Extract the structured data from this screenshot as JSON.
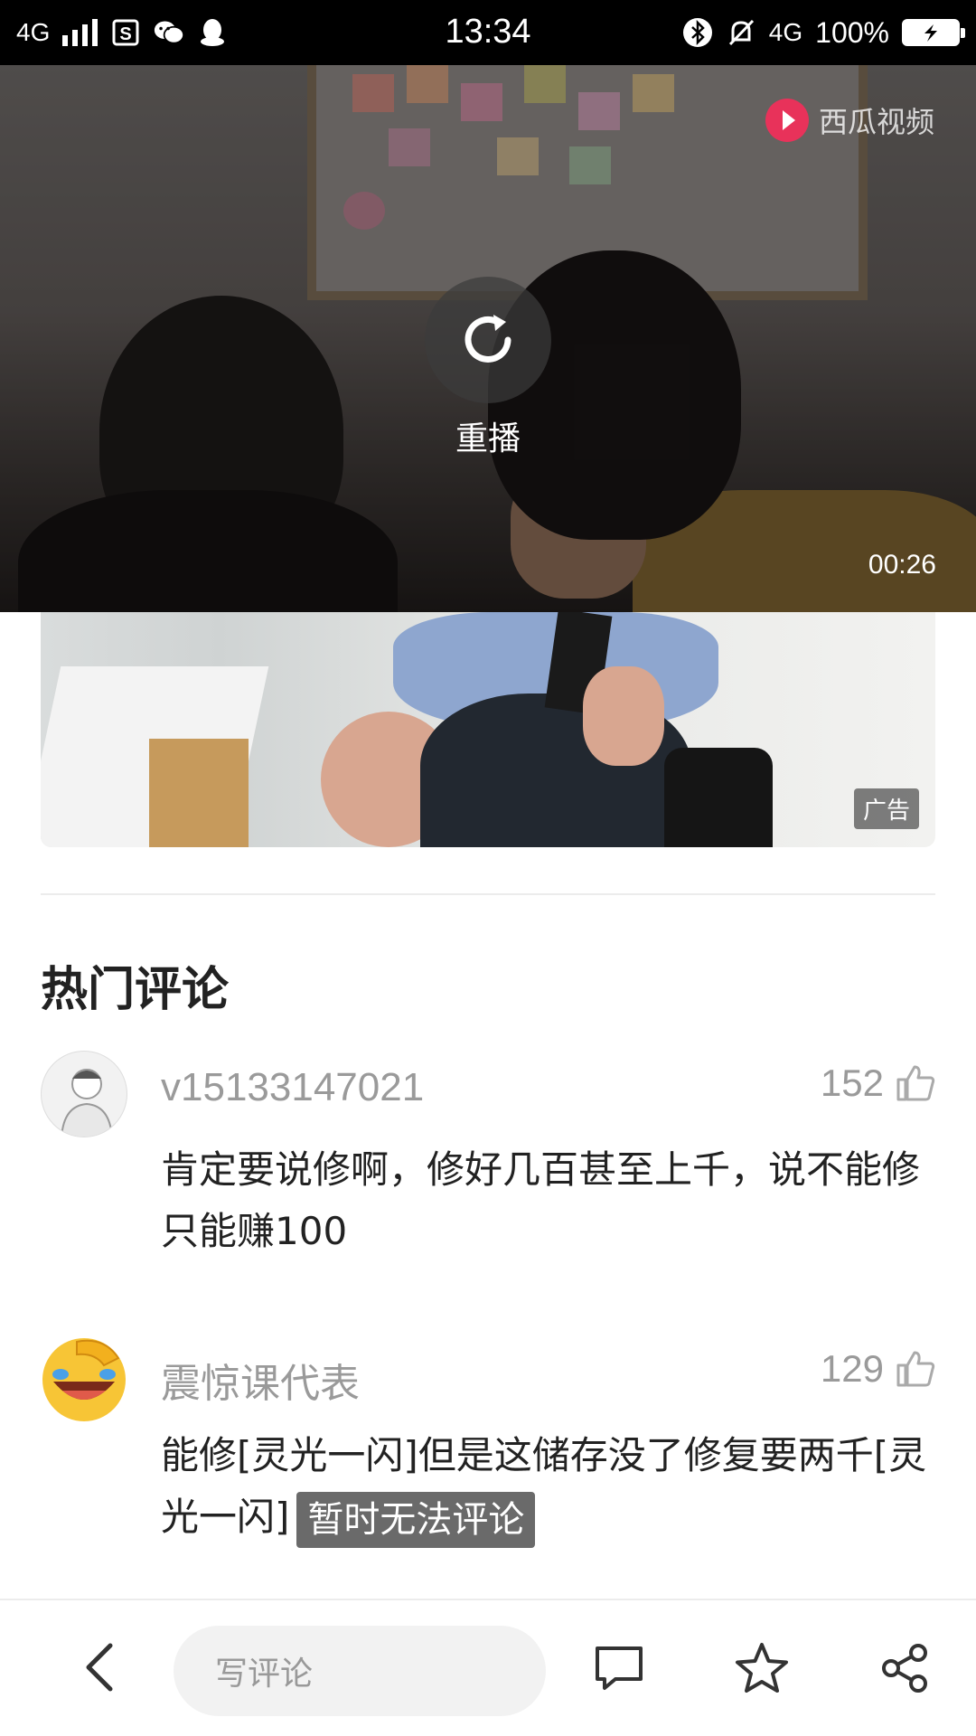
{
  "status_bar": {
    "network_left": "4G",
    "time": "13:34",
    "network_right": "4G",
    "battery_percent": "100%",
    "icons": [
      "signal-icon",
      "sim-s-icon",
      "wechat-icon",
      "qq-icon",
      "bluetooth-icon",
      "mute-icon",
      "battery-charging-icon"
    ]
  },
  "video": {
    "watermark_text": "西瓜视频",
    "replay_label": "重播",
    "duration": "00:26"
  },
  "ad": {
    "badge": "广告"
  },
  "comments_section": {
    "title": "热门评论",
    "comments": [
      {
        "username": "v15133147021",
        "likes": "152",
        "text": "肯定要说修啊，修好几百甚至上千，说不能修只能赚100"
      },
      {
        "username": "震惊课代表",
        "likes": "129",
        "text": "能修[灵光一闪]但是这储存没了修复要两千[灵光一闪]"
      }
    ]
  },
  "toast": "暂时无法评论",
  "bottom_bar": {
    "input_placeholder": "写评论",
    "icons": [
      "back-arrow-icon",
      "comment-icon",
      "star-icon",
      "share-icon"
    ]
  },
  "colors": {
    "accent_logo": "#e8325a",
    "text_primary": "#222222",
    "text_secondary": "#9a9a9a"
  }
}
